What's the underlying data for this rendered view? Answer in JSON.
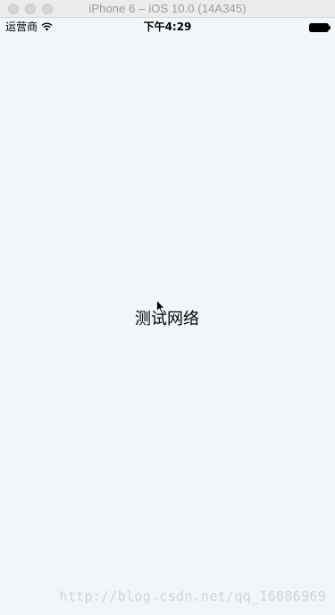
{
  "window": {
    "title": "iPhone 6 – iOS 10.0 (14A345)"
  },
  "status_bar": {
    "carrier": "运营商",
    "time": "下午4:29",
    "wifi_icon": "wifi-icon",
    "battery_icon": "battery-icon"
  },
  "main": {
    "button_label": "测试网络"
  },
  "watermark": {
    "text": "http://blog.csdn.net/qq_16086969"
  },
  "colors": {
    "screen_background": "#f2f6f9",
    "titlebar_background": "#ececec",
    "text": "#000000"
  }
}
